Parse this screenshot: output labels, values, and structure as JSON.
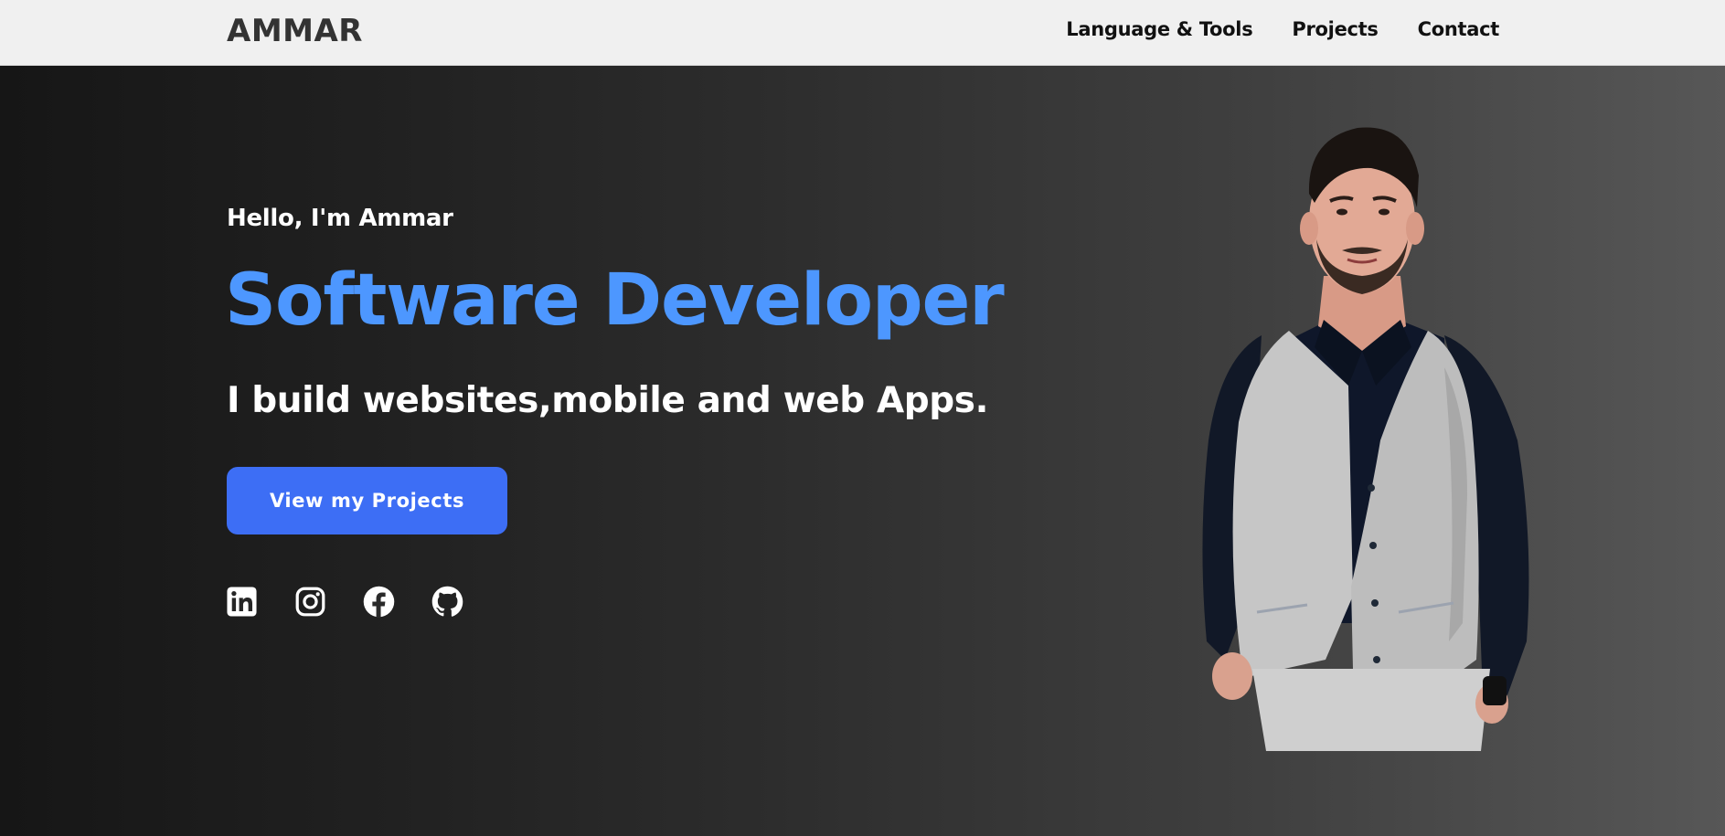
{
  "brand": {
    "name": "AMMAR"
  },
  "nav": {
    "items": [
      {
        "label": "Language & Tools"
      },
      {
        "label": "Projects"
      },
      {
        "label": "Contact"
      }
    ]
  },
  "hero": {
    "greeting": "Hello, I'm Ammar",
    "role": "Software Developer",
    "tagline": "I build websites,mobile and web Apps.",
    "cta_label": "View my Projects",
    "socials": [
      {
        "icon": "linkedin-icon"
      },
      {
        "icon": "instagram-icon"
      },
      {
        "icon": "facebook-icon"
      },
      {
        "icon": "github-icon"
      }
    ]
  },
  "colors": {
    "accent": "#4d97ff",
    "button": "#3d6ef5",
    "navbar": "#f0f0f0",
    "hero_dark": "#161616",
    "hero_light": "#575757"
  }
}
